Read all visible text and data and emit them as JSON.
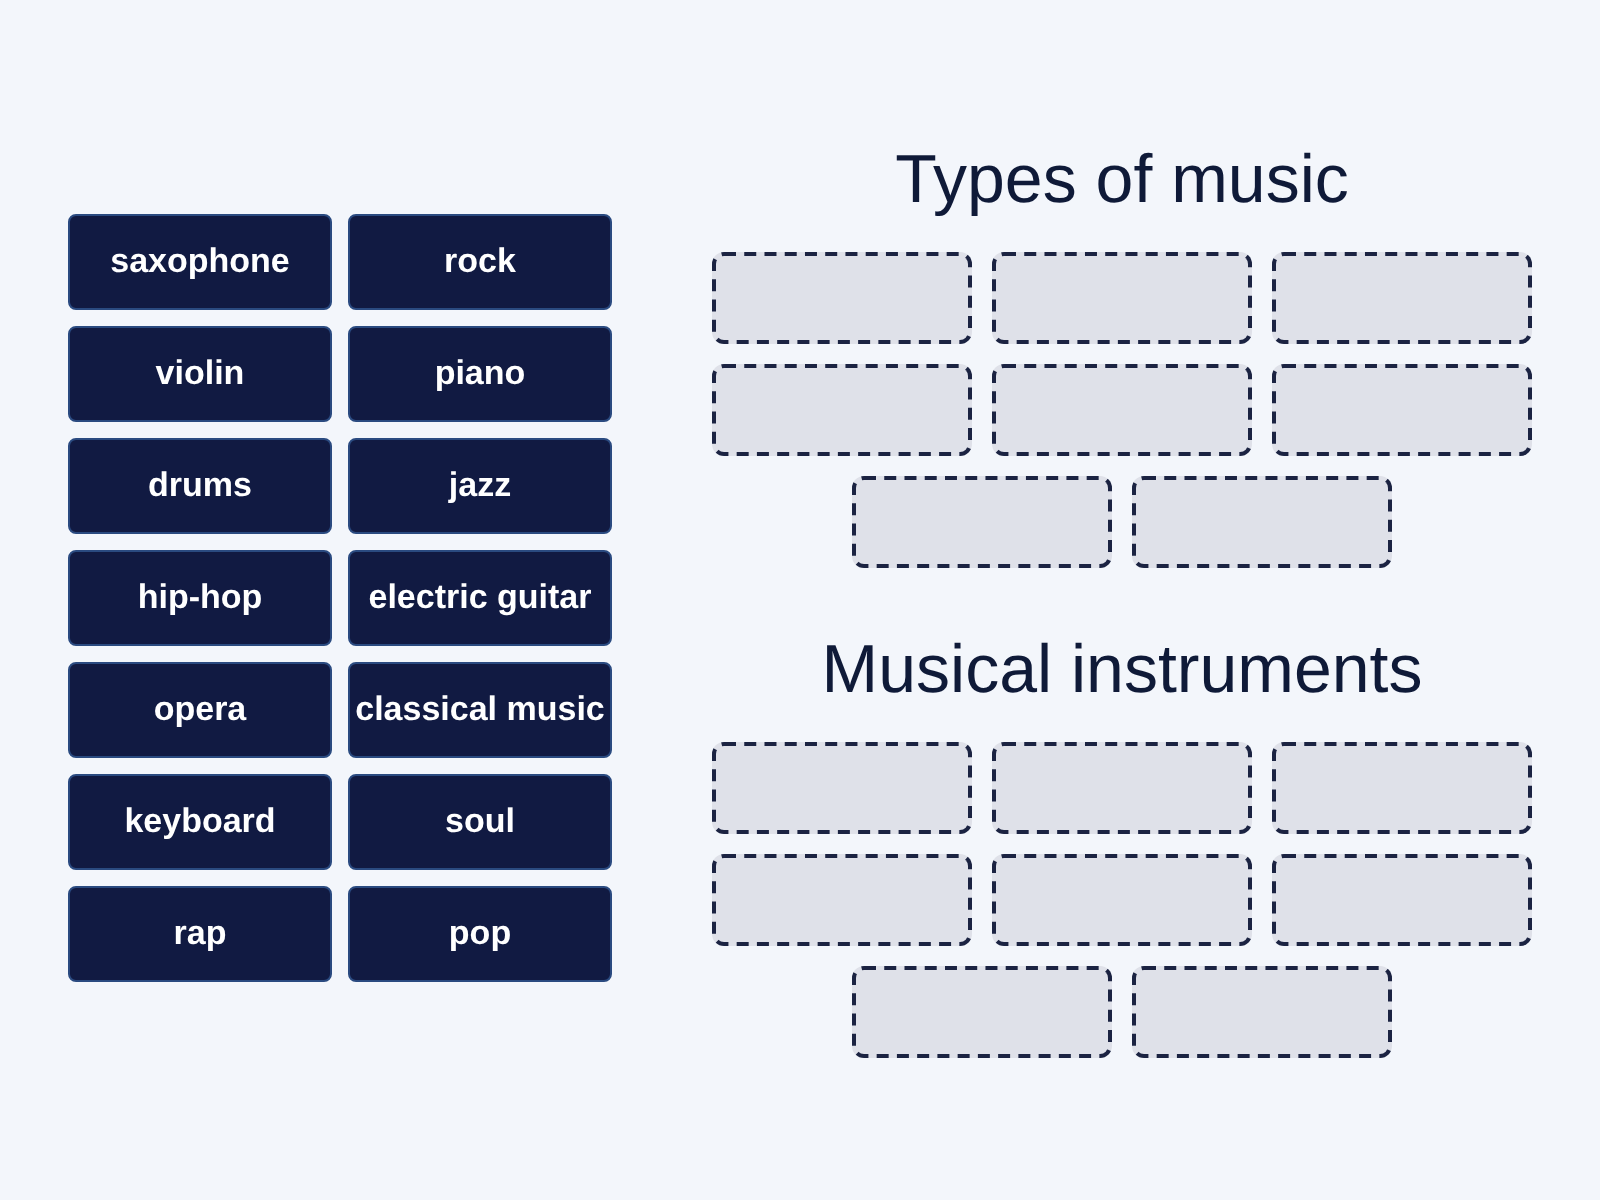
{
  "tiles": [
    {
      "label": "saxophone"
    },
    {
      "label": "rock"
    },
    {
      "label": "violin"
    },
    {
      "label": "piano"
    },
    {
      "label": "drums"
    },
    {
      "label": "jazz"
    },
    {
      "label": "hip-hop"
    },
    {
      "label": "electric guitar"
    },
    {
      "label": "opera"
    },
    {
      "label": "classical music"
    },
    {
      "label": "keyboard"
    },
    {
      "label": "soul"
    },
    {
      "label": "rap"
    },
    {
      "label": "pop"
    }
  ],
  "groups": [
    {
      "title": "Types of music",
      "slots": [
        {
          "filled": false
        },
        {
          "filled": false
        },
        {
          "filled": false
        },
        {
          "filled": false
        },
        {
          "filled": false
        },
        {
          "filled": false
        },
        {
          "filled": false
        },
        {
          "filled": false
        }
      ]
    },
    {
      "title": "Musical instruments",
      "slots": [
        {
          "filled": false
        },
        {
          "filled": false
        },
        {
          "filled": false
        },
        {
          "filled": false
        },
        {
          "filled": false
        },
        {
          "filled": false
        },
        {
          "filled": false
        },
        {
          "filled": false
        }
      ]
    }
  ]
}
